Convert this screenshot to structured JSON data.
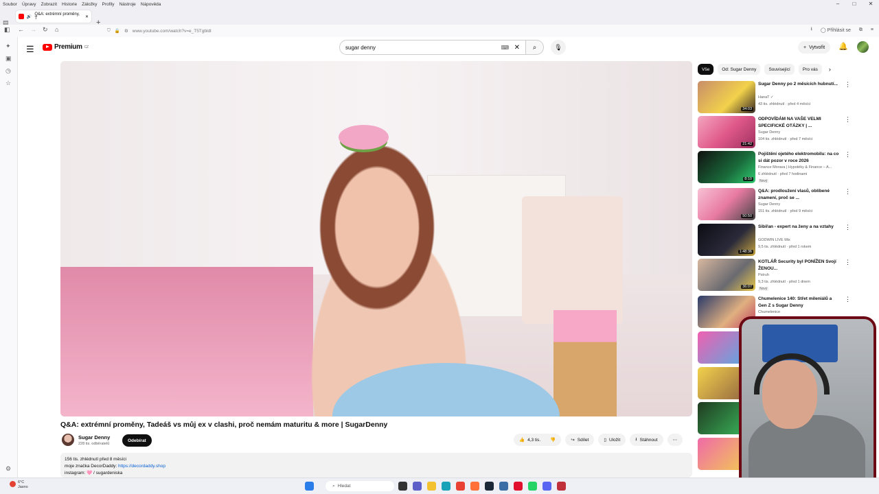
{
  "browser": {
    "menu": [
      "Soubor",
      "Úpravy",
      "Zobrazit",
      "Historie",
      "Záložky",
      "Profily",
      "Nástroje",
      "Nápověda"
    ],
    "tab_title": "Q&A: extrémní proměny, T",
    "url": "www.youtube.com/watch?v=e_T5Tgbldl",
    "signin": "Přihlásit se"
  },
  "yt": {
    "logo": "Premium",
    "logo_sup": "CZ",
    "search_value": "sugar denny",
    "create_label": "Vytvořit"
  },
  "video": {
    "title": "Q&A: extrémní proměny, Tadeáš vs můj ex v clashi, proč nemám maturitu & more | SugarDenny",
    "channel": "Sugar Denny",
    "subs": "228 tis. odběratelů",
    "subscribe": "Odebírat",
    "likes": "4,3 tis.",
    "share": "Sdílet",
    "save": "Uložit",
    "download": "Stáhnout",
    "desc_stats": "156 tis. zhlédnutí  před 8 měsíci",
    "desc_line2": "moje značka DecorDaddy: ",
    "desc_link": "https://decordaddy.shop",
    "desc_line3": "instagram: 🩷 / sugardeniska"
  },
  "chips": [
    "Vše",
    "Od: Sugar Denny",
    "Související",
    "Pro vás"
  ],
  "recs": [
    {
      "title": "Sugar Denny po 2 měsících hubnutí...",
      "channel": "HanaT ✓",
      "meta": "43 tis. zhlédnutí · před 4 měsíci",
      "dur": "34:03",
      "badge": ""
    },
    {
      "title": "ODPOVÍDÁM NA VAŠE VELMI SPECIFICKÉ OTÁZKY | ...",
      "channel": "Sugar Denny",
      "meta": "104 tis. zhlédnutí · před 7 měsíci",
      "dur": "21:42",
      "badge": ""
    },
    {
      "title": "Pojištění ojetého elektromobilu: na co si dát pozor v roce 2026",
      "channel": "Finance Morava | Hypotéky & Finance – A...",
      "meta": "6 zhlédnutí · před 7 hodinami",
      "dur": "8:10",
      "badge": "Nový"
    },
    {
      "title": "Q&A: prodloužení vlasů, oblíbené znamení, proč se ...",
      "channel": "Sugar Denny",
      "meta": "151 tis. zhlédnutí · před 9 měsíci",
      "dur": "50:50",
      "badge": ""
    },
    {
      "title": "Sibiřan -  expert na ženy a na vztahy",
      "channel": "GODWIN LIVE Mix",
      "meta": "9,5 tis. zhlédnutí · před 1 rokem",
      "dur": "1:48:36",
      "badge": ""
    },
    {
      "title": "KOTLÁŘ Security byl PONÍŽEN Svojí ŽENOU...",
      "channel": "Pstruh",
      "meta": "9,3 tis. zhlédnutí · před 1 dnem",
      "dur": "36:07",
      "badge": "Nový"
    },
    {
      "title": "Chumelenice 140: Střet mileniálů a Gen Z s Sugar Denny",
      "channel": "Chumelenice",
      "meta": "",
      "dur": "",
      "badge": ""
    }
  ],
  "taskbar": {
    "temp": "6°C",
    "weather": "Jasno",
    "search": "Hledat"
  },
  "colors": {
    "accent": "#ff0000",
    "link": "#065fd4",
    "webcam_border": "#6b0a14"
  }
}
